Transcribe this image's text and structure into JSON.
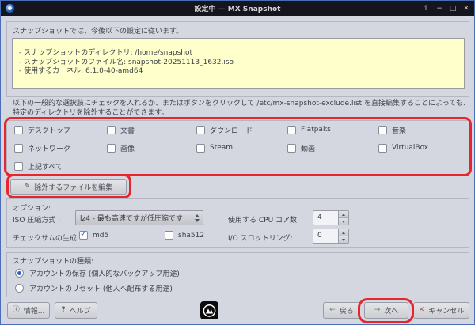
{
  "window": {
    "title": "設定中 — MX Snapshot",
    "controls": {
      "shade": "↑",
      "minimize": "−",
      "maximize": "□",
      "close": "✕"
    }
  },
  "colors": {
    "titlebar_bg": "#15151d",
    "window_border": "#4a6db8",
    "dialog_bg": "#d4d7df",
    "info_box_bg": "#ffffcb",
    "annotation_red": "#e8252d",
    "accent_blue": "#2f62c4"
  },
  "icons": {
    "check": "✓",
    "pencil": "✎",
    "info": "ⓘ",
    "help": "?",
    "back_arrow": "←",
    "next_arrow": "→",
    "cancel_x": "✕"
  },
  "intro": {
    "text": "スナップショットでは、今後以下の設定に従います。"
  },
  "info_box": {
    "lines": [
      "- スナップショットのディレクトリ: /home/snapshot",
      "- スナップショットのファイル名: snapshot-20251113_1632.iso",
      "- 使用するカーネル: 6.1.0-40-amd64"
    ]
  },
  "exclusion": {
    "description": "以下の一般的な選択肢にチェックを入れるか、またはボタンをクリックして /etc/mx-snapshot-exclude.list を直接編集することによっても、特定のディレクトリを除外することができます。",
    "checkboxes": [
      {
        "label": "デスクトップ",
        "checked": false
      },
      {
        "label": "文書",
        "checked": false
      },
      {
        "label": "ダウンロード",
        "checked": false
      },
      {
        "label": "Flatpaks",
        "checked": false
      },
      {
        "label": "音楽",
        "checked": false
      },
      {
        "label": "ネットワーク",
        "checked": false
      },
      {
        "label": "画像",
        "checked": false
      },
      {
        "label": "Steam",
        "checked": false
      },
      {
        "label": "動画",
        "checked": false
      },
      {
        "label": "VirtualBox",
        "checked": false
      },
      {
        "label": "上記すべて",
        "checked": false
      }
    ],
    "edit_button_label": "除外するファイルを編集"
  },
  "options": {
    "title": "オプション:",
    "iso_compression_label": "ISO 圧縮方式 :",
    "iso_compression_value": "lz4 - 最も高速ですが低圧縮です",
    "cpu_cores_label": "使用する CPU コア数:",
    "cpu_cores_value": "4",
    "checksum_label": "チェックサムの生成:",
    "md5_label": "md5",
    "md5_checked": true,
    "sha512_label": "sha512",
    "sha512_checked": false,
    "io_throttle_label": "I/O スロットリング:",
    "io_throttle_value": "0"
  },
  "snapshot_type": {
    "title": "スナップショットの種類:",
    "options": [
      {
        "label": "アカウントの保存 (個人的なバックアップ用途)",
        "selected": true
      },
      {
        "label": "アカウントのリセット (他人へ配布する用途)",
        "selected": false
      }
    ]
  },
  "footer": {
    "about_label": "情報...",
    "help_label": "ヘルプ",
    "back_label": "戻る",
    "next_label": "次へ",
    "cancel_label": "キャンセル"
  }
}
